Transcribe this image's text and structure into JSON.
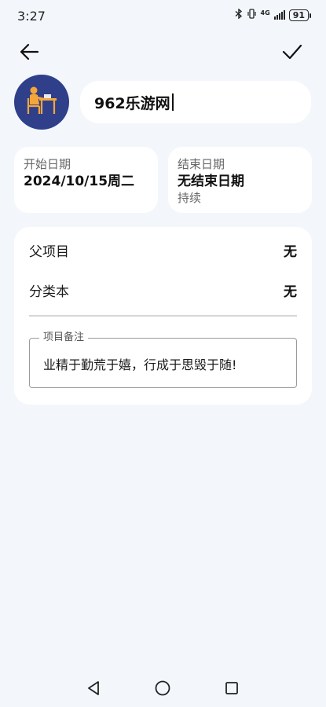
{
  "status_bar": {
    "time": "3:27",
    "network": "4G",
    "battery": "91"
  },
  "toolbar": {
    "back_icon": "arrow-left-icon",
    "confirm_icon": "check-icon"
  },
  "project": {
    "avatar_icon": "person-at-desk-icon",
    "title": "962乐游网"
  },
  "dates": {
    "start_label": "开始日期",
    "start_value": "2024/10/15周二",
    "end_label": "结束日期",
    "end_value": "无结束日期",
    "end_sub": "持续"
  },
  "details": {
    "parent_label": "父项目",
    "parent_value": "无",
    "category_label": "分类本",
    "category_value": "无",
    "notes_label": "项目备注",
    "notes_text": "业精于勤荒于嬉，行成于思毁于随!"
  },
  "colors": {
    "background": "#f3f7fb",
    "card": "#ffffff",
    "avatar_bg": "#2f3f8a",
    "avatar_accent": "#f4a63a"
  }
}
